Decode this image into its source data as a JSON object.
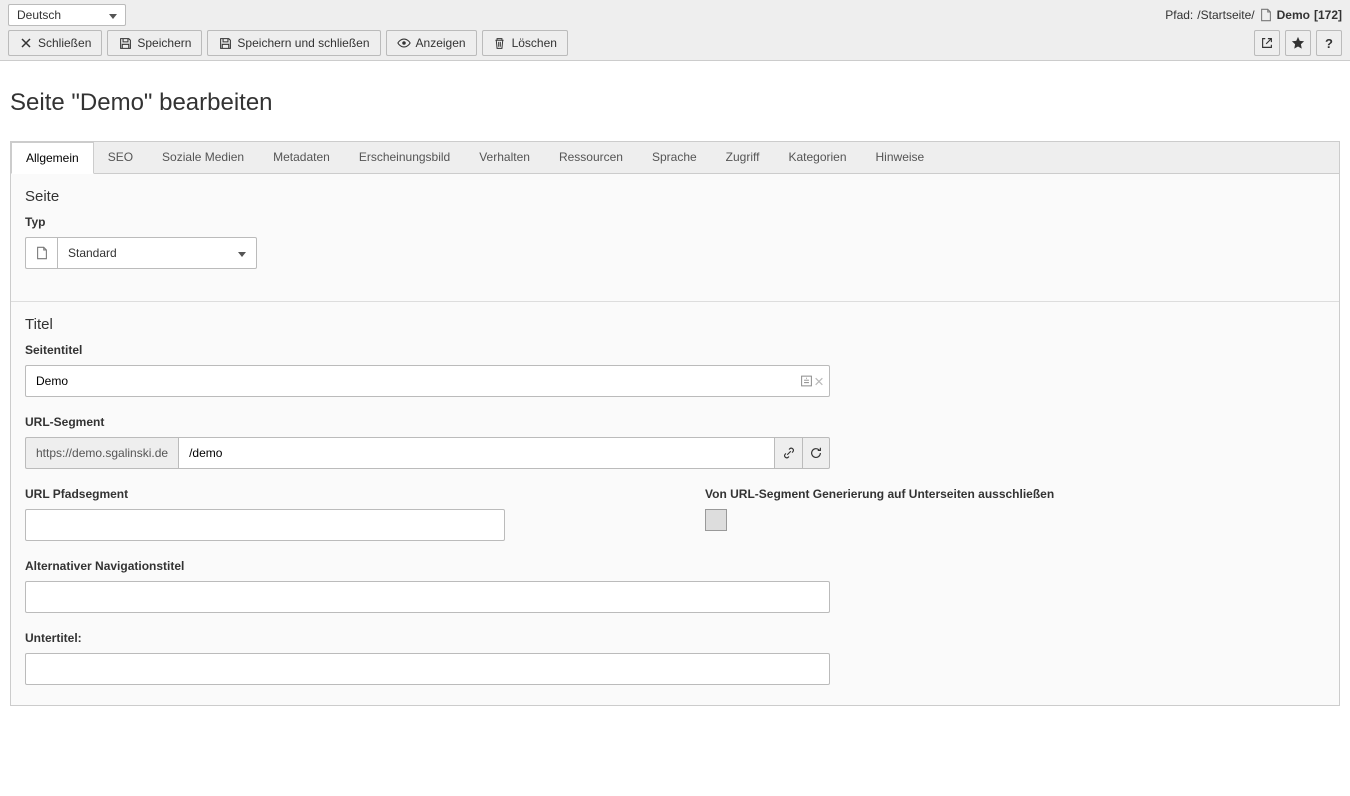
{
  "topbar": {
    "language": "Deutsch",
    "path_label": "Pfad:",
    "path_value": "/Startseite/",
    "page_name": "Demo",
    "page_id": "[172]"
  },
  "actions": {
    "close": "Schließen",
    "save": "Speichern",
    "save_close": "Speichern und schließen",
    "view": "Anzeigen",
    "delete": "Löschen"
  },
  "heading": "Seite \"Demo\" bearbeiten",
  "tabs": [
    "Allgemein",
    "SEO",
    "Soziale Medien",
    "Metadaten",
    "Erscheinungsbild",
    "Verhalten",
    "Ressourcen",
    "Sprache",
    "Zugriff",
    "Kategorien",
    "Hinweise"
  ],
  "section_page": {
    "title": "Seite",
    "type_label": "Typ",
    "type_value": "Standard"
  },
  "section_title": {
    "title": "Titel",
    "pagetitle_label": "Seitentitel",
    "pagetitle_value": "Demo",
    "urlseg_label": "URL-Segment",
    "urlseg_prefix": "https://demo.sgalinski.de",
    "urlseg_value": "/demo",
    "urlpath_label": "URL Pfadsegment",
    "urlpath_value": "",
    "exclude_label": "Von URL-Segment Generierung auf Unterseiten ausschließen",
    "navtitle_label": "Alternativer Navigationstitel",
    "navtitle_value": "",
    "subtitle_label": "Untertitel:",
    "subtitle_value": ""
  }
}
